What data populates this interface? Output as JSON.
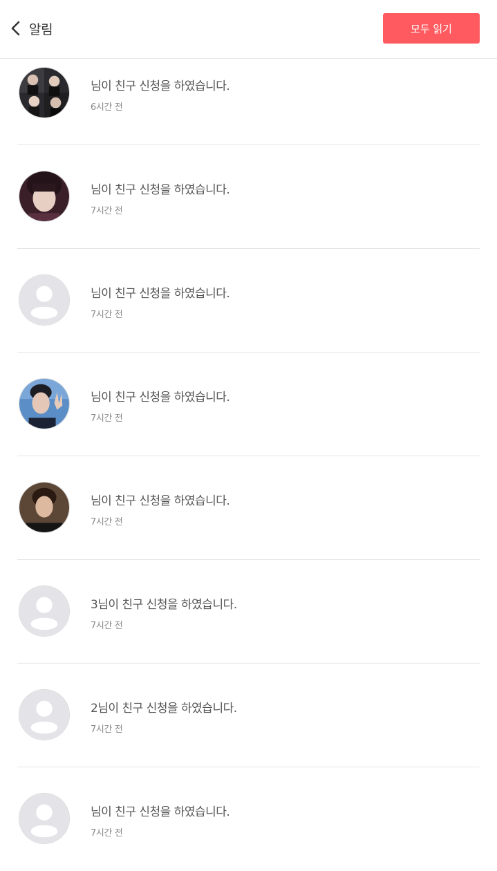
{
  "header": {
    "title": "알림",
    "read_all_label": "모두 읽기",
    "accent_color": "#ff5a5f"
  },
  "notifications": [
    {
      "name": " ",
      "suffix": "님이 친구 신청을 하였습니다.",
      "time": "6시간 전",
      "avatar": "photo-group"
    },
    {
      "name": " ",
      "suffix": "님이 친구 신청을 하였습니다.",
      "time": "7시간 전",
      "avatar": "photo-person"
    },
    {
      "name": " ",
      "suffix": "님이 친구 신청을 하였습니다.",
      "time": "7시간 전",
      "avatar": "default-avatar-icon"
    },
    {
      "name": " ",
      "suffix": "님이 친구 신청을 하였습니다.",
      "time": "7시간 전",
      "avatar": "photo-person"
    },
    {
      "name": " ",
      "suffix": "님이 친구 신청을 하였습니다.",
      "time": "7시간 전",
      "avatar": "photo-person"
    },
    {
      "name": "3",
      "suffix": "님이 친구 신청을 하였습니다.",
      "time": "7시간 전",
      "avatar": "default-avatar-icon"
    },
    {
      "name": "2",
      "suffix": "님이 친구 신청을 하였습니다.",
      "time": "7시간 전",
      "avatar": "default-avatar-icon"
    },
    {
      "name": " ",
      "suffix": "님이 친구 신청을 하였습니다.",
      "time": "7시간 전",
      "avatar": "default-avatar-icon"
    }
  ]
}
